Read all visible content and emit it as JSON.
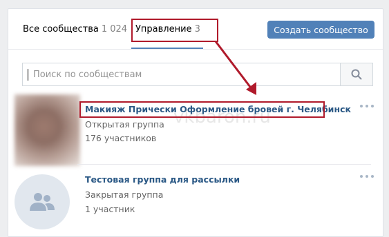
{
  "tabs": {
    "all_label": "Все сообщества",
    "all_count": "1 024",
    "manage_label": "Управление",
    "manage_count": "3"
  },
  "create_button": "Создать сообщество",
  "search": {
    "placeholder": "Поиск по сообществам"
  },
  "communities": [
    {
      "name": "Макияж Прически Оформление бровей г. Челябинск",
      "type": "Открытая группа",
      "members": "176 участников"
    },
    {
      "name": "Тестовая группа для рассылки",
      "type": "Закрытая группа",
      "members": "1 участник"
    }
  ],
  "watermark": "vkbaron.ru",
  "colors": {
    "accent": "#5181b8",
    "link": "#2a5885",
    "annotation": "#b01a2b"
  }
}
